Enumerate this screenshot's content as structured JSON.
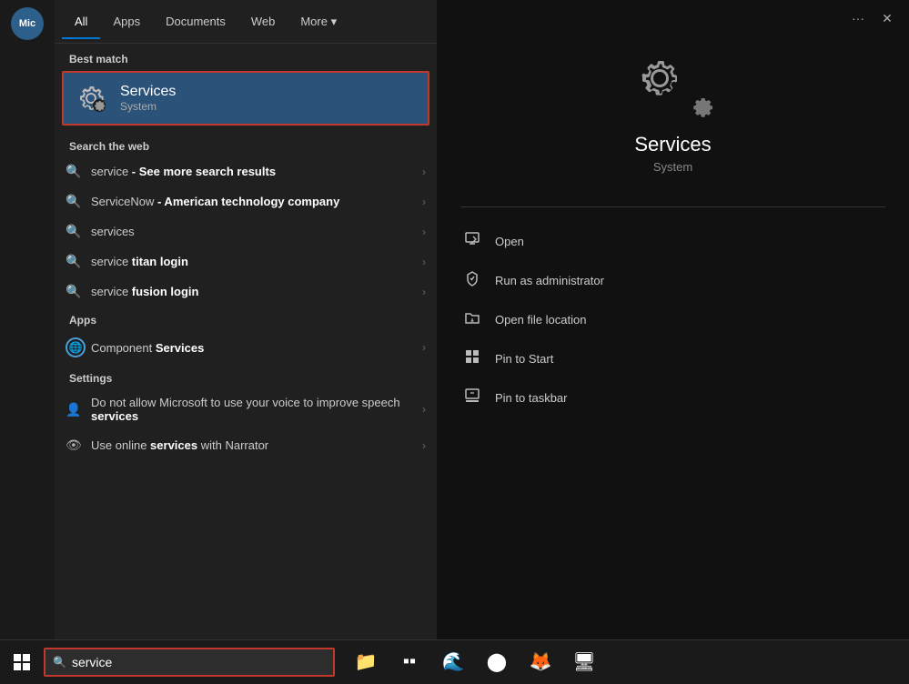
{
  "tabs": {
    "items": [
      {
        "label": "All",
        "active": true
      },
      {
        "label": "Apps",
        "active": false
      },
      {
        "label": "Documents",
        "active": false
      },
      {
        "label": "Web",
        "active": false
      },
      {
        "label": "More ▾",
        "active": false
      }
    ]
  },
  "best_match": {
    "section_label": "Best match",
    "title": "Services",
    "subtitle": "System",
    "icon_label": "services-gear-icon"
  },
  "web_search": {
    "section_label": "Search the web",
    "items": [
      {
        "text_plain": "service",
        "text_bold": " - See more search results",
        "has_arrow": true
      },
      {
        "text_plain": "ServiceNow",
        "text_bold": " - American technology company",
        "has_arrow": true
      },
      {
        "text_plain": "services",
        "text_bold": "",
        "has_arrow": true
      },
      {
        "text_plain": "service ",
        "text_bold": "titan login",
        "has_arrow": true
      },
      {
        "text_plain": "service ",
        "text_bold": "fusion login",
        "has_arrow": true
      }
    ]
  },
  "apps_section": {
    "label": "Apps",
    "items": [
      {
        "text_plain": "Component ",
        "text_bold": "Services",
        "has_arrow": true
      }
    ]
  },
  "settings_section": {
    "label": "Settings",
    "items": [
      {
        "text_plain": "Do not allow Microsoft to use your voice to improve speech ",
        "text_bold": "services",
        "has_arrow": true
      },
      {
        "text_plain": "Use online ",
        "text_bold": "services",
        "text_after": " with Narrator",
        "has_arrow": true
      }
    ]
  },
  "right_panel": {
    "title": "Services",
    "subtitle": "System",
    "actions": [
      {
        "label": "Open",
        "icon": "open-icon"
      },
      {
        "label": "Run as administrator",
        "icon": "run-admin-icon"
      },
      {
        "label": "Open file location",
        "icon": "folder-icon"
      },
      {
        "label": "Pin to Start",
        "icon": "pin-start-icon"
      },
      {
        "label": "Pin to taskbar",
        "icon": "pin-taskbar-icon"
      }
    ]
  },
  "taskbar": {
    "search_text": "service",
    "search_placeholder": "service"
  },
  "controls": {
    "ellipsis": "···",
    "close": "✕"
  }
}
